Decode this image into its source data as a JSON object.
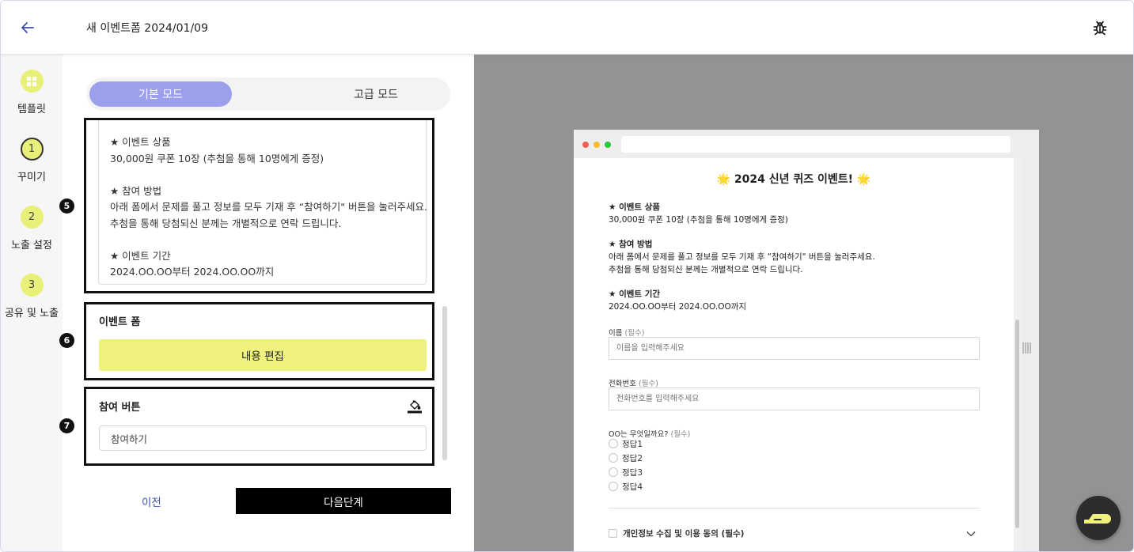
{
  "header": {
    "title": "새 이벤트폼 2024/01/09",
    "back_icon": "arrow-left-icon",
    "bug_icon": "bug-icon"
  },
  "steps": [
    {
      "marker": "",
      "label": "템플릿",
      "icon": "grid-icon"
    },
    {
      "marker": "1",
      "label": "꾸미기",
      "active": true
    },
    {
      "marker": "2",
      "label": "노출 설정"
    },
    {
      "marker": "3",
      "label": "공유 및 노출"
    }
  ],
  "mode": {
    "basic": "기본 모드",
    "advanced": "고급 모드",
    "selected": "basic"
  },
  "description_lines": [
    "★ 이벤트 상품",
    "30,000원 쿠폰 10장 (추첨을 통해 10명에게 증정)",
    "",
    "★ 참여 방법",
    "아래 폼에서 문제를 풀고 정보를 모두 기재 후 “참여하기\" 버튼을 눌러주세요.",
    "추첨을 통해 당첨되신 분께는 개별적으로 연락 드립니다.",
    "",
    "★ 이벤트 기간",
    "2024.OO.OO부터 2024.OO.OO까지"
  ],
  "markers": {
    "m5": "5",
    "m6": "6",
    "m7": "7"
  },
  "event_form": {
    "title": "이벤트 폼",
    "edit_button": "내용 편집"
  },
  "join_button_section": {
    "title": "참여 버튼",
    "input_value": "참여하기",
    "paint_icon": "paint-bucket-icon"
  },
  "nav": {
    "prev": "이전",
    "next": "다음단계"
  },
  "preview": {
    "title": "🌟 2024 신년 퀴즈 이벤트! 🌟",
    "lines": [
      {
        "text": "★ 이벤트 상품",
        "bold": true
      },
      {
        "text": "30,000원 쿠폰 10장 (추첨을 통해 10명에게 증정)",
        "bold": false
      },
      {
        "text": "★ 참여 방법",
        "bold": true
      },
      {
        "text": "아래 폼에서 문제를 풀고 정보를 모두 기재 후 “참여하기\" 버튼을 눌러주세요.",
        "bold": false
      },
      {
        "text": "추첨을 통해 당첨되신 분께는 개별적으로 연락 드립니다.",
        "bold": false
      },
      {
        "text": "★ 이벤트 기간",
        "bold": true
      },
      {
        "text": "2024.OO.OO부터 2024.OO.OO까지",
        "bold": false
      }
    ],
    "name_label": "이름",
    "name_req": "(필수)",
    "name_placeholder": "이름을 입력해주세요",
    "phone_label": "전화번호",
    "phone_req": "(필수)",
    "phone_placeholder": "전화번호를 입력해주세요",
    "quiz_label": "OO는 무엇일까요?",
    "quiz_req": "(필수)",
    "options": [
      "정답1",
      "정답2",
      "정답3",
      "정답4"
    ],
    "consent": "개인정보 수집 및 이용 동의 (필수)"
  },
  "colors": {
    "accent_purple": "#9ca0ec",
    "accent_yellow": "#eff27c",
    "step_yellow": "#e8f07a",
    "link_blue": "#3d4fa8",
    "preview_bg": "#939393"
  }
}
